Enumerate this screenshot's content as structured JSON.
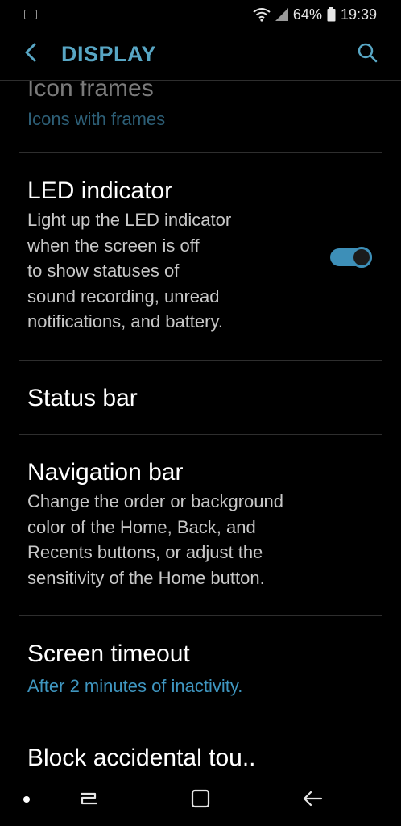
{
  "status_bar": {
    "battery_percent": "64%",
    "time": "19:39"
  },
  "app_bar": {
    "title": "DISPLAY"
  },
  "items": [
    {
      "title": "Icon frames",
      "subtitle": "Icons with frames"
    },
    {
      "title": "LED indicator",
      "subtitle_lines": [
        "Light up the LED indicator",
        "when the screen is off",
        "to show statuses of",
        "sound recording, unread",
        "notifications, and battery."
      ],
      "toggle_on": true
    },
    {
      "title": "Status bar"
    },
    {
      "title": "Navigation bar",
      "subtitle_lines": [
        "Change the order or background",
        "color of the Home, Back, and",
        "Recents buttons, or adjust the",
        "sensitivity of the Home button."
      ]
    },
    {
      "title": "Screen timeout",
      "subtitle": "After 2 minutes of inactivity."
    },
    {
      "title": "Block accidental tou.."
    }
  ],
  "colors": {
    "accent": "#58a6c4",
    "link": "#3f96c0",
    "toggle": "#3d8fb8",
    "background": "#000000"
  },
  "icons": {
    "back": "chevron-left-icon",
    "search": "search-icon",
    "wifi": "wifi-icon",
    "signal": "signal-icon",
    "battery": "battery-icon",
    "nav_recents": "recents-icon",
    "nav_home": "home-icon",
    "nav_back": "back-arrow-icon"
  }
}
